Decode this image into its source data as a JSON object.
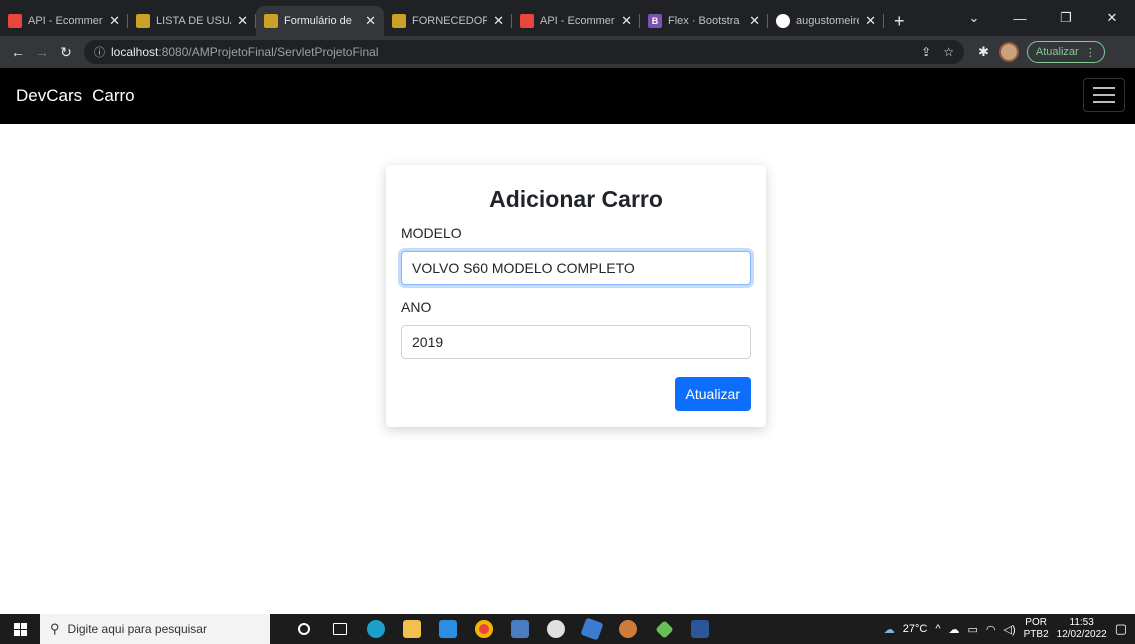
{
  "browser": {
    "tabs": [
      {
        "title": "API - Ecommer",
        "fav_color": "#e8453c",
        "active": false
      },
      {
        "title": "LISTA DE USUÁ",
        "fav_color": "#c9a227",
        "active": false
      },
      {
        "title": "Formulário de",
        "fav_color": "#c9a227",
        "active": true
      },
      {
        "title": "FORNECEDORI",
        "fav_color": "#c9a227",
        "active": false
      },
      {
        "title": "API - Ecommer",
        "fav_color": "#e8453c",
        "active": false
      },
      {
        "title": "Flex · Bootstra",
        "fav_color": "#7952b3",
        "active": false,
        "fav_letter": "B"
      },
      {
        "title": "augustomeirel",
        "fav_color": "#ffffff",
        "active": false
      }
    ],
    "url_host": "localhost",
    "url_path": ":8080/AMProjetoFinal/ServletProjetoFinal",
    "update_label": "Atualizar"
  },
  "navbar": {
    "brand": "DevCars",
    "link": "Carro"
  },
  "form": {
    "title": "Adicionar Carro",
    "modelo_label": "MODELO",
    "modelo_value": "VOLVO S60 MODELO COMPLETO",
    "ano_label": "ANO",
    "ano_value": "2019",
    "submit_label": "Atualizar"
  },
  "taskbar": {
    "search_placeholder": "Digite aqui para pesquisar",
    "weather": "27°C",
    "lang_top": "POR",
    "lang_bottom": "PTB2",
    "time": "11:53",
    "date": "12/02/2022"
  },
  "colors": {
    "primary": "#0d6efd",
    "navbar_bg": "#000000"
  }
}
